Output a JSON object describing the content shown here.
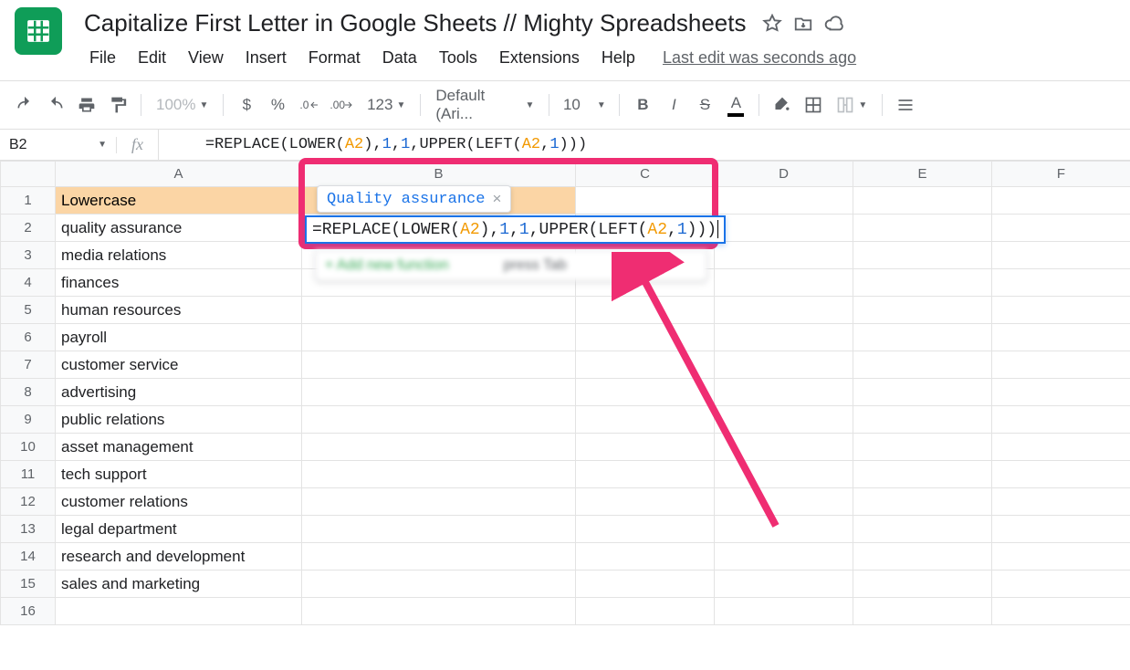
{
  "doc": {
    "title": "Capitalize First Letter in Google Sheets // Mighty Spreadsheets",
    "last_edit": "Last edit was seconds ago"
  },
  "menu": {
    "file": "File",
    "edit": "Edit",
    "view": "View",
    "insert": "Insert",
    "format": "Format",
    "data": "Data",
    "tools": "Tools",
    "extensions": "Extensions",
    "help": "Help"
  },
  "toolbar": {
    "zoom": "100%",
    "currency": "$",
    "percent": "%",
    "dec_dec": ".0",
    "dec_inc": ".00",
    "numfmt": "123",
    "font": "Default (Ari...",
    "size": "10"
  },
  "fx": {
    "namebox": "B2",
    "formula_func1": "=REPLACE",
    "formula_open1": "(",
    "formula_func2": "LOWER",
    "formula_open2": "(",
    "ref1": "A2",
    "close1": ")",
    "comma1": ",",
    "num1": "1",
    "comma2": ",",
    "num2": "1",
    "comma3": ",",
    "formula_func3": "UPPER",
    "formula_open3": "(",
    "formula_func4": "LEFT",
    "formula_open4": "(",
    "ref2": "A2",
    "comma4": ",",
    "num3": "1",
    "close2": ")",
    "close3": ")",
    "close4": ")"
  },
  "columns": {
    "A": "A",
    "B": "B",
    "C": "C",
    "D": "D",
    "E": "E",
    "F": "F"
  },
  "rows": {
    "header": "Lowercase",
    "r": [
      "quality assurance",
      "media relations",
      "finances",
      "human resources",
      "payroll",
      "customer service",
      "advertising",
      "public relations",
      "asset management",
      "tech support",
      "customer relations",
      "legal department",
      "research and development",
      "sales and marketing"
    ]
  },
  "preview": {
    "text": "Quality assurance",
    "close": "×"
  },
  "suggest": {
    "text": "+  Add new function",
    "hint": "press Tab",
    "dots": "⋮"
  }
}
